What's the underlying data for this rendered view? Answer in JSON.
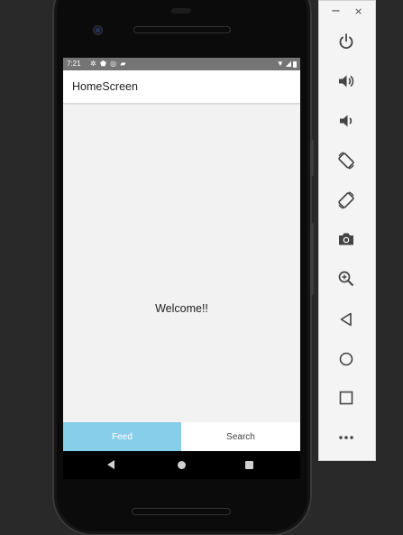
{
  "statusbar": {
    "time": "7:21",
    "left_icons": [
      "settings-icon",
      "shield-icon",
      "data-saver-icon",
      "sd-card-icon"
    ],
    "right_icons": [
      "wifi-icon",
      "signal-icon",
      "battery-icon"
    ]
  },
  "app": {
    "title": "HomeScreen",
    "welcome_text": "Welcome!!",
    "tabs": [
      {
        "label": "Feed",
        "active": true
      },
      {
        "label": "Search",
        "active": false
      }
    ],
    "colors": {
      "active_tab": "#87ceeb",
      "status_bar": "#757575"
    }
  },
  "emulator_panel": {
    "window_controls": {
      "minimize": "−",
      "close": "×"
    },
    "buttons": [
      "power-icon",
      "volume-up-icon",
      "volume-down-icon",
      "rotate-left-icon",
      "rotate-right-icon",
      "camera-icon",
      "zoom-icon",
      "back-icon",
      "home-icon",
      "overview-icon",
      "more-icon"
    ]
  }
}
